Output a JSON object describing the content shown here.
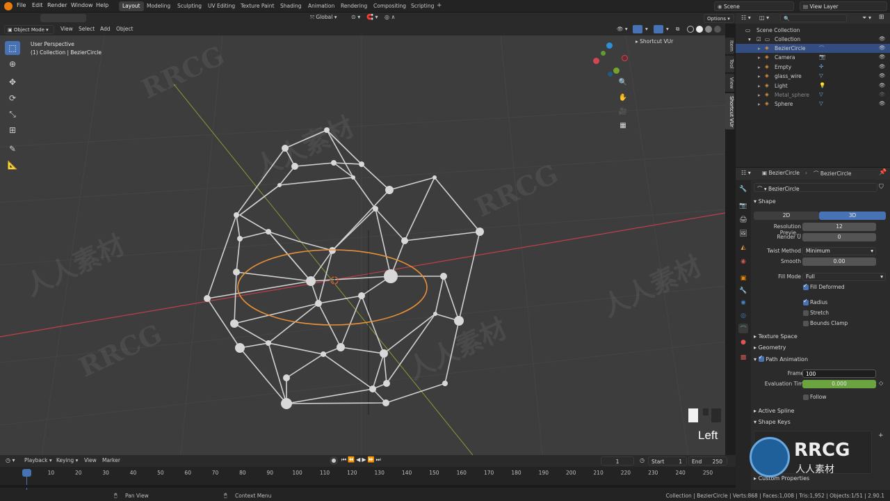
{
  "top_menu": [
    "File",
    "Edit",
    "Render",
    "Window",
    "Help"
  ],
  "workspaces": [
    "Layout",
    "Modeling",
    "Sculpting",
    "UV Editing",
    "Texture Paint",
    "Shading",
    "Animation",
    "Rendering",
    "Compositing",
    "Scripting"
  ],
  "scene": {
    "name": "Scene",
    "view_layer": "View Layer"
  },
  "viewport_header": {
    "mode": "Object Mode",
    "menus": [
      "View",
      "Select",
      "Add",
      "Object"
    ],
    "transform_orientation": "Global",
    "options": "Options"
  },
  "viewport": {
    "perspective": "User Perspective",
    "collection_info": "(1) Collection | BezierCircle",
    "view_name": "Left"
  },
  "n_panel": {
    "header": "Shortcut VUr",
    "tabs": [
      "Item",
      "Tool",
      "View",
      "Shortcut VUr"
    ]
  },
  "outliner": {
    "root": "Scene Collection",
    "collection": "Collection",
    "items": [
      {
        "name": "BezierCircle",
        "selected": true,
        "icon": "curve-icon"
      },
      {
        "name": "Camera",
        "selected": false,
        "icon": "camera-icon"
      },
      {
        "name": "Empty",
        "selected": false,
        "icon": "empty-icon"
      },
      {
        "name": "glass_wire",
        "selected": false,
        "icon": "mesh-icon"
      },
      {
        "name": "Light",
        "selected": false,
        "icon": "light-icon"
      },
      {
        "name": "Metal_sphere",
        "selected": false,
        "icon": "mesh-icon"
      },
      {
        "name": "Sphere",
        "selected": false,
        "icon": "mesh-icon"
      }
    ]
  },
  "properties": {
    "breadcrumb_object": "BezierCircle",
    "breadcrumb_data": "BezierCircle",
    "datablock_name": "BezierCircle",
    "shape_panel": "Shape",
    "dim_2d": "2D",
    "dim_3d": "3D",
    "resolution_preview_label": "Resolution Previe...",
    "resolution_preview_value": "12",
    "render_u_label": "Render U",
    "render_u_value": "0",
    "twist_method_label": "Twist Method",
    "twist_method_value": "Minimum",
    "smooth_label": "Smooth",
    "smooth_value": "0.00",
    "fill_mode_label": "Fill Mode",
    "fill_mode_value": "Full",
    "fill_deformed": "Fill Deformed",
    "radius": "Radius",
    "stretch": "Stretch",
    "bounds_clamp": "Bounds Clamp",
    "texture_space": "Texture Space",
    "geometry": "Geometry",
    "path_animation": "Path Animation",
    "frames_label": "Frames",
    "frames_value": "100",
    "evaluation_time_label": "Evaluation Time",
    "evaluation_time_value": "0.000",
    "follow": "Follow",
    "active_spline": "Active Spline",
    "shape_keys": "Shape Keys",
    "custom_properties": "Custom Properties"
  },
  "timeline": {
    "menus": [
      "Playback",
      "Keying",
      "View",
      "Marker"
    ],
    "current_frame": "1",
    "start_label": "Start",
    "start_value": "1",
    "end_label": "End",
    "end_value": "250",
    "ticks": [
      "1",
      "10",
      "20",
      "30",
      "40",
      "50",
      "60",
      "70",
      "80",
      "90",
      "100",
      "110",
      "120",
      "130",
      "140",
      "150",
      "160",
      "170",
      "180",
      "190",
      "200",
      "210",
      "220",
      "230",
      "240",
      "250"
    ]
  },
  "status_bar": {
    "left_hint": "Pan View",
    "mid_hint": "Context Menu",
    "stats": "Collection | BezierCircle | Verts:868 | Faces:1,008 | Tris:1,952 | Objects:1/51 | 2.90.1"
  },
  "watermarks": [
    "RRCG",
    "人人素材"
  ],
  "colors": {
    "accent_blue": "#4772b3",
    "selected_row": "#334d80",
    "eval_time_green": "#6aa33f",
    "x_axis_red": "#c0404a",
    "y_axis_olive": "#8a9a3a",
    "bezier_orange": "#e8913a"
  }
}
